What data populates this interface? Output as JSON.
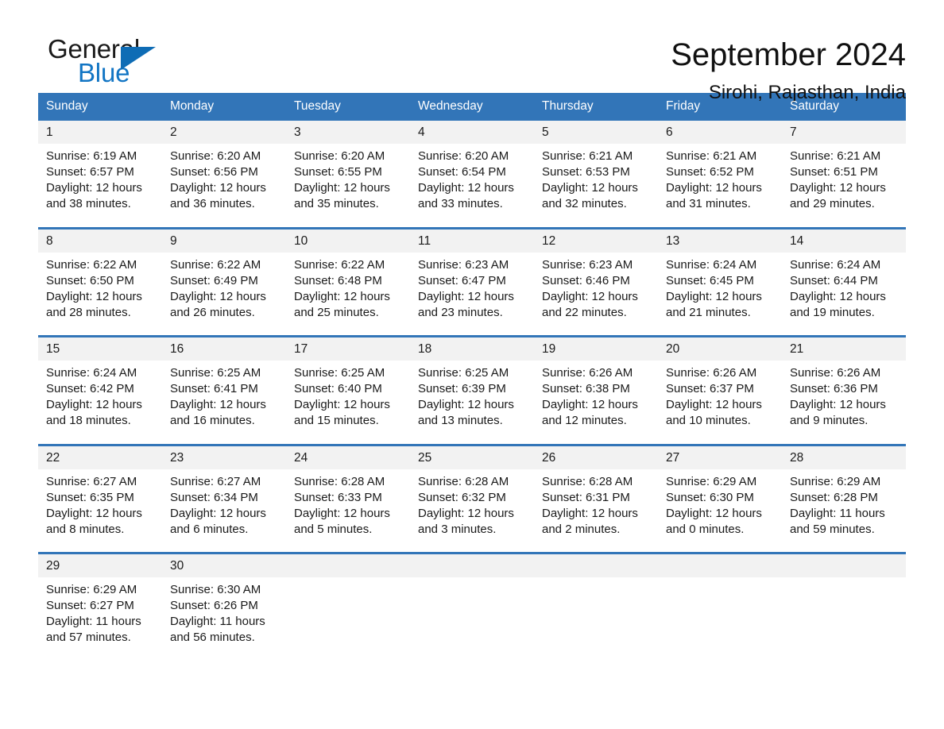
{
  "brand": {
    "name_part1": "General",
    "name_part2": "Blue",
    "triangle_color": "#0e6cb5"
  },
  "header": {
    "title": "September 2024",
    "subtitle": "Sirohi, Rajasthan, India"
  },
  "theme": {
    "header_blue": "#3275b8",
    "date_band_gray": "#f2f2f2",
    "text_color": "#1a1a1a"
  },
  "weekday_headers": [
    "Sunday",
    "Monday",
    "Tuesday",
    "Wednesday",
    "Thursday",
    "Friday",
    "Saturday"
  ],
  "labels": {
    "sunrise_prefix": "Sunrise:",
    "sunset_prefix": "Sunset:",
    "daylight_prefix": "Daylight:"
  },
  "weeks": [
    {
      "days": [
        {
          "date": "1",
          "sunrise": "Sunrise: 6:19 AM",
          "sunset": "Sunset: 6:57 PM",
          "daylight_line1": "Daylight: 12 hours",
          "daylight_line2": "and 38 minutes."
        },
        {
          "date": "2",
          "sunrise": "Sunrise: 6:20 AM",
          "sunset": "Sunset: 6:56 PM",
          "daylight_line1": "Daylight: 12 hours",
          "daylight_line2": "and 36 minutes."
        },
        {
          "date": "3",
          "sunrise": "Sunrise: 6:20 AM",
          "sunset": "Sunset: 6:55 PM",
          "daylight_line1": "Daylight: 12 hours",
          "daylight_line2": "and 35 minutes."
        },
        {
          "date": "4",
          "sunrise": "Sunrise: 6:20 AM",
          "sunset": "Sunset: 6:54 PM",
          "daylight_line1": "Daylight: 12 hours",
          "daylight_line2": "and 33 minutes."
        },
        {
          "date": "5",
          "sunrise": "Sunrise: 6:21 AM",
          "sunset": "Sunset: 6:53 PM",
          "daylight_line1": "Daylight: 12 hours",
          "daylight_line2": "and 32 minutes."
        },
        {
          "date": "6",
          "sunrise": "Sunrise: 6:21 AM",
          "sunset": "Sunset: 6:52 PM",
          "daylight_line1": "Daylight: 12 hours",
          "daylight_line2": "and 31 minutes."
        },
        {
          "date": "7",
          "sunrise": "Sunrise: 6:21 AM",
          "sunset": "Sunset: 6:51 PM",
          "daylight_line1": "Daylight: 12 hours",
          "daylight_line2": "and 29 minutes."
        }
      ]
    },
    {
      "days": [
        {
          "date": "8",
          "sunrise": "Sunrise: 6:22 AM",
          "sunset": "Sunset: 6:50 PM",
          "daylight_line1": "Daylight: 12 hours",
          "daylight_line2": "and 28 minutes."
        },
        {
          "date": "9",
          "sunrise": "Sunrise: 6:22 AM",
          "sunset": "Sunset: 6:49 PM",
          "daylight_line1": "Daylight: 12 hours",
          "daylight_line2": "and 26 minutes."
        },
        {
          "date": "10",
          "sunrise": "Sunrise: 6:22 AM",
          "sunset": "Sunset: 6:48 PM",
          "daylight_line1": "Daylight: 12 hours",
          "daylight_line2": "and 25 minutes."
        },
        {
          "date": "11",
          "sunrise": "Sunrise: 6:23 AM",
          "sunset": "Sunset: 6:47 PM",
          "daylight_line1": "Daylight: 12 hours",
          "daylight_line2": "and 23 minutes."
        },
        {
          "date": "12",
          "sunrise": "Sunrise: 6:23 AM",
          "sunset": "Sunset: 6:46 PM",
          "daylight_line1": "Daylight: 12 hours",
          "daylight_line2": "and 22 minutes."
        },
        {
          "date": "13",
          "sunrise": "Sunrise: 6:24 AM",
          "sunset": "Sunset: 6:45 PM",
          "daylight_line1": "Daylight: 12 hours",
          "daylight_line2": "and 21 minutes."
        },
        {
          "date": "14",
          "sunrise": "Sunrise: 6:24 AM",
          "sunset": "Sunset: 6:44 PM",
          "daylight_line1": "Daylight: 12 hours",
          "daylight_line2": "and 19 minutes."
        }
      ]
    },
    {
      "days": [
        {
          "date": "15",
          "sunrise": "Sunrise: 6:24 AM",
          "sunset": "Sunset: 6:42 PM",
          "daylight_line1": "Daylight: 12 hours",
          "daylight_line2": "and 18 minutes."
        },
        {
          "date": "16",
          "sunrise": "Sunrise: 6:25 AM",
          "sunset": "Sunset: 6:41 PM",
          "daylight_line1": "Daylight: 12 hours",
          "daylight_line2": "and 16 minutes."
        },
        {
          "date": "17",
          "sunrise": "Sunrise: 6:25 AM",
          "sunset": "Sunset: 6:40 PM",
          "daylight_line1": "Daylight: 12 hours",
          "daylight_line2": "and 15 minutes."
        },
        {
          "date": "18",
          "sunrise": "Sunrise: 6:25 AM",
          "sunset": "Sunset: 6:39 PM",
          "daylight_line1": "Daylight: 12 hours",
          "daylight_line2": "and 13 minutes."
        },
        {
          "date": "19",
          "sunrise": "Sunrise: 6:26 AM",
          "sunset": "Sunset: 6:38 PM",
          "daylight_line1": "Daylight: 12 hours",
          "daylight_line2": "and 12 minutes."
        },
        {
          "date": "20",
          "sunrise": "Sunrise: 6:26 AM",
          "sunset": "Sunset: 6:37 PM",
          "daylight_line1": "Daylight: 12 hours",
          "daylight_line2": "and 10 minutes."
        },
        {
          "date": "21",
          "sunrise": "Sunrise: 6:26 AM",
          "sunset": "Sunset: 6:36 PM",
          "daylight_line1": "Daylight: 12 hours",
          "daylight_line2": "and 9 minutes."
        }
      ]
    },
    {
      "days": [
        {
          "date": "22",
          "sunrise": "Sunrise: 6:27 AM",
          "sunset": "Sunset: 6:35 PM",
          "daylight_line1": "Daylight: 12 hours",
          "daylight_line2": "and 8 minutes."
        },
        {
          "date": "23",
          "sunrise": "Sunrise: 6:27 AM",
          "sunset": "Sunset: 6:34 PM",
          "daylight_line1": "Daylight: 12 hours",
          "daylight_line2": "and 6 minutes."
        },
        {
          "date": "24",
          "sunrise": "Sunrise: 6:28 AM",
          "sunset": "Sunset: 6:33 PM",
          "daylight_line1": "Daylight: 12 hours",
          "daylight_line2": "and 5 minutes."
        },
        {
          "date": "25",
          "sunrise": "Sunrise: 6:28 AM",
          "sunset": "Sunset: 6:32 PM",
          "daylight_line1": "Daylight: 12 hours",
          "daylight_line2": "and 3 minutes."
        },
        {
          "date": "26",
          "sunrise": "Sunrise: 6:28 AM",
          "sunset": "Sunset: 6:31 PM",
          "daylight_line1": "Daylight: 12 hours",
          "daylight_line2": "and 2 minutes."
        },
        {
          "date": "27",
          "sunrise": "Sunrise: 6:29 AM",
          "sunset": "Sunset: 6:30 PM",
          "daylight_line1": "Daylight: 12 hours",
          "daylight_line2": "and 0 minutes."
        },
        {
          "date": "28",
          "sunrise": "Sunrise: 6:29 AM",
          "sunset": "Sunset: 6:28 PM",
          "daylight_line1": "Daylight: 11 hours",
          "daylight_line2": "and 59 minutes."
        }
      ]
    },
    {
      "days": [
        {
          "date": "29",
          "sunrise": "Sunrise: 6:29 AM",
          "sunset": "Sunset: 6:27 PM",
          "daylight_line1": "Daylight: 11 hours",
          "daylight_line2": "and 57 minutes."
        },
        {
          "date": "30",
          "sunrise": "Sunrise: 6:30 AM",
          "sunset": "Sunset: 6:26 PM",
          "daylight_line1": "Daylight: 11 hours",
          "daylight_line2": "and 56 minutes."
        },
        {
          "date": "",
          "sunrise": "",
          "sunset": "",
          "daylight_line1": "",
          "daylight_line2": ""
        },
        {
          "date": "",
          "sunrise": "",
          "sunset": "",
          "daylight_line1": "",
          "daylight_line2": ""
        },
        {
          "date": "",
          "sunrise": "",
          "sunset": "",
          "daylight_line1": "",
          "daylight_line2": ""
        },
        {
          "date": "",
          "sunrise": "",
          "sunset": "",
          "daylight_line1": "",
          "daylight_line2": ""
        },
        {
          "date": "",
          "sunrise": "",
          "sunset": "",
          "daylight_line1": "",
          "daylight_line2": ""
        }
      ]
    }
  ]
}
